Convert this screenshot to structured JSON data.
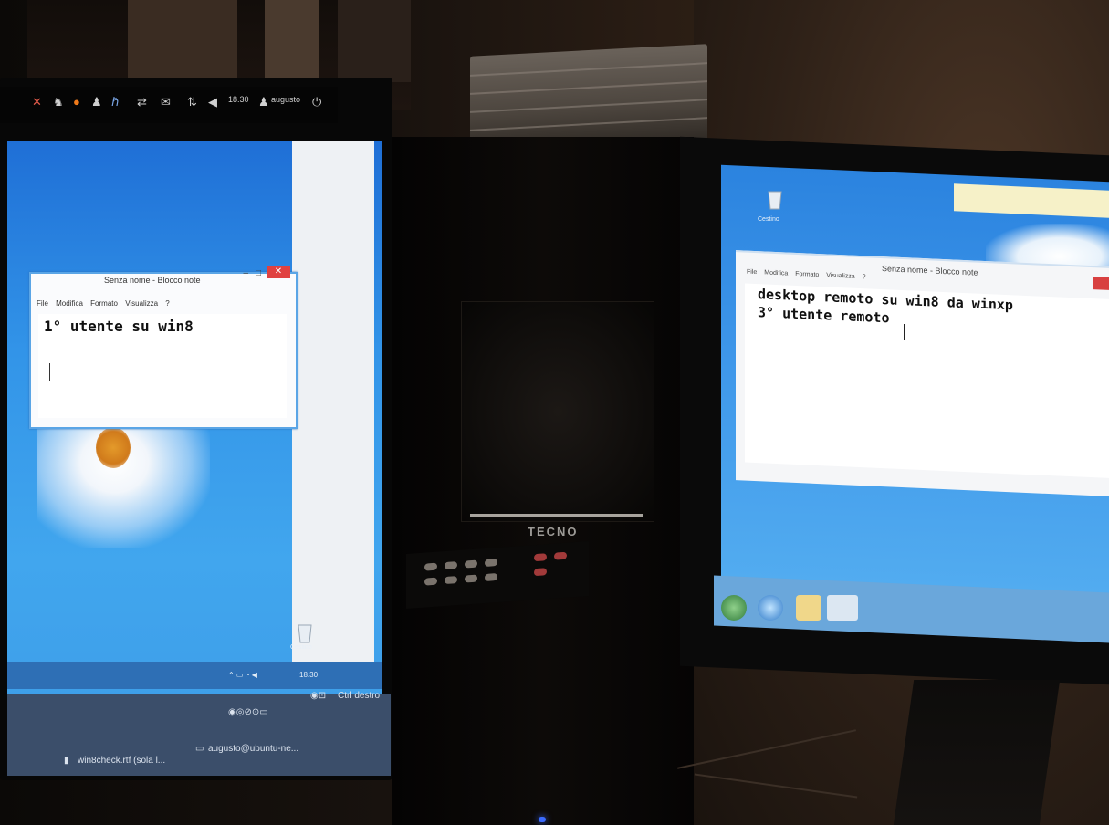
{
  "left_monitor": {
    "ubuntu_panel": {
      "time": "18.30",
      "user": "augusto"
    },
    "notepad": {
      "title": "Senza nome - Blocco note",
      "menu": [
        "File",
        "Modifica",
        "Formato",
        "Visualizza",
        "?"
      ],
      "text": "1° utente su win8"
    },
    "recycle_bin_label": "Cestino",
    "tray_time": "18.30",
    "host_taskbar": {
      "item1": "win8check.rtf (sola l...",
      "item2": "augusto@ubuntu-ne...",
      "ctrl_label": "Ctrl destro"
    }
  },
  "right_monitor": {
    "notepad": {
      "title": "Senza nome - Blocco note",
      "menu": [
        "File",
        "Modifica",
        "Formato",
        "Visualizza",
        "?"
      ],
      "line1": "desktop remoto su win8 da winxp",
      "line2": "3° utente remoto"
    },
    "recycle_bin_label": "Cestino"
  },
  "tower": {
    "brand": "TECNO"
  }
}
